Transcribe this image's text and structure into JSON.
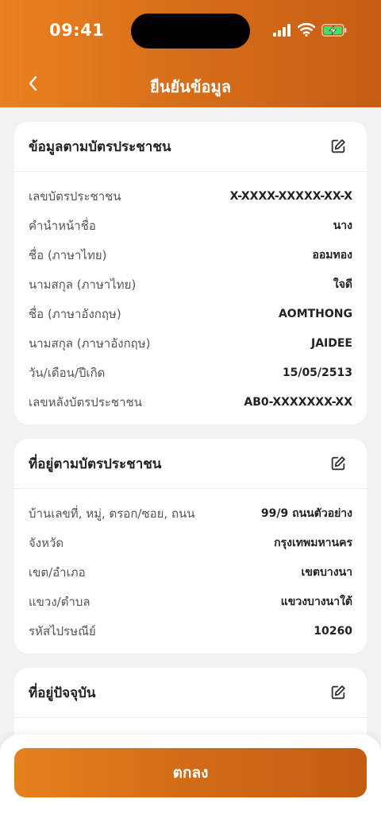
{
  "status": {
    "time": "09:41"
  },
  "nav": {
    "title": "ยืนยันข้อมูล"
  },
  "id_card": {
    "title": "ข้อมูลตามบัตรประชาชน",
    "rows": [
      {
        "label": "เลขบัตรประชาชน",
        "value": "X-XXXX-XXXXX-XX-X"
      },
      {
        "label": "คำนำหน้าชื่อ",
        "value": "นาง"
      },
      {
        "label": "ชื่อ (ภาษาไทย)",
        "value": "ออมทอง"
      },
      {
        "label": "นามสกุล (ภาษาไทย)",
        "value": "ใจดี"
      },
      {
        "label": "ชื่อ (ภาษาอังกฤษ)",
        "value": "AOMTHONG"
      },
      {
        "label": "นามสกุล (ภาษาอังกฤษ)",
        "value": "JAIDEE"
      },
      {
        "label": "วัน/เดือน/ปีเกิด",
        "value": "15/05/2513"
      },
      {
        "label": "เลขหลังบัตรประชาชน",
        "value": "AB0-XXXXXXX-XX"
      }
    ]
  },
  "id_address": {
    "title": "ที่อยู่ตามบัตรประชาชน",
    "rows": [
      {
        "label": "บ้านเลขที่, หมู่, ตรอก/ซอย, ถนน",
        "value": "99/9 ถนนตัวอย่าง"
      },
      {
        "label": "จังหวัด",
        "value": "กรุงเทพมหานคร"
      },
      {
        "label": "เขต/อำเภอ",
        "value": "เขตบางนา"
      },
      {
        "label": "แขวง/ตำบล",
        "value": "แขวงบางนาใต้"
      },
      {
        "label": "รหัสไปรษณีย์",
        "value": "10260"
      }
    ]
  },
  "current_address": {
    "title": "ที่อยู่ปัจจุบัน"
  },
  "confirm": {
    "label": "ตกลง"
  },
  "colors": {
    "accent": "#d86f1a",
    "background": "#f2f2f4"
  }
}
